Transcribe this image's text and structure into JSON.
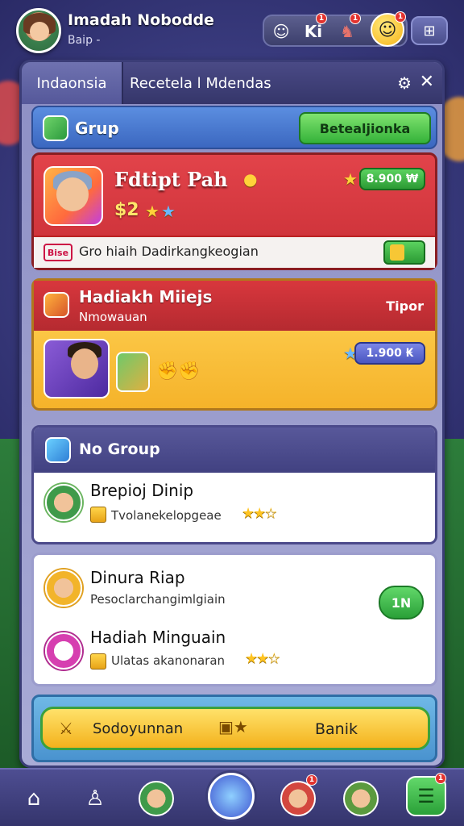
{
  "player": {
    "name": "Imadah Nobodde",
    "sub": "Baip -"
  },
  "topbar": {
    "icons": [
      "friend-icon",
      "ki-icon",
      "robot-icon",
      "smile-icon",
      "grid-icon"
    ],
    "ki_label": "Ki",
    "badges": [
      "1",
      "1",
      "1"
    ]
  },
  "panel": {
    "tabs": [
      "Indaonsia",
      "Recetela l Mdendas"
    ],
    "grup_label": "Grup",
    "grup_button": "Betealjionka",
    "red_card": {
      "title": "Fdtipt Pah",
      "sub": "$2",
      "pill": "8.900 ₩",
      "footer_tag": "Bise",
      "footer_text": "Gro hiaih Dadirkangkeogian"
    },
    "orange_card": {
      "title": "Hadiakh Miiejs",
      "sub": "Nmowauan",
      "right": "Tipor",
      "pill": "1.900 ₭"
    },
    "no_group": {
      "label": "No Group",
      "row_title": "Brepioj Dinip",
      "row_sub": "Tvolanekelopgeae"
    },
    "list": {
      "items": [
        {
          "title": "Dinura Riap",
          "sub": "Pesoclarchangimlgiain"
        },
        {
          "title": "Hadiah Minguain",
          "sub": "Ulatas akanonaran"
        }
      ],
      "button": "1N"
    },
    "actions": {
      "left": "Sodoyunnan",
      "right": "Banik"
    }
  },
  "bottom_nav": [
    "home-icon",
    "profile-icon",
    "friend-avatar-icon",
    "center-hero-icon",
    "chat-avatar-icon",
    "elf-avatar-icon",
    "leaderboard-icon"
  ],
  "colors": {
    "accent_green": "#35b23a",
    "red": "#c92f36",
    "gold": "#f5b32a",
    "navy": "#34346c"
  }
}
